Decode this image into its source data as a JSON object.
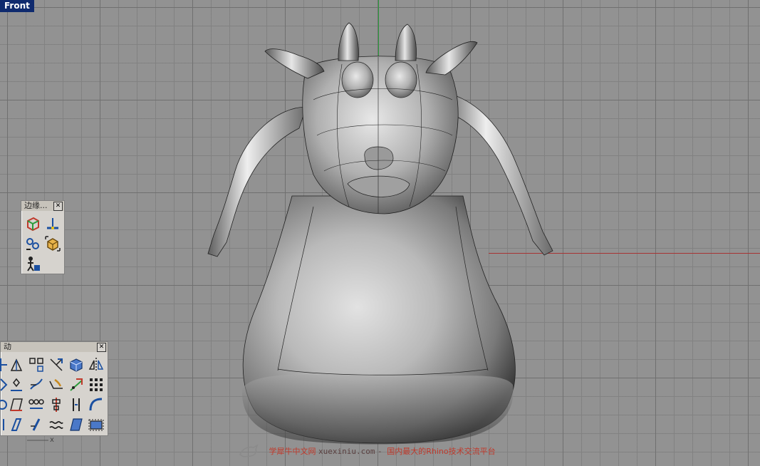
{
  "viewport": {
    "label": "Front"
  },
  "toolbars": {
    "edge": {
      "title": "边缘...",
      "close": "✕"
    },
    "transform": {
      "title": "动",
      "close": "✕"
    }
  },
  "watermark": {
    "site": "学犀牛中文网",
    "url": "xuexiniu.com",
    "sep": " - ",
    "slogan": "国内最大的Rhino技术交流平台"
  },
  "axis_indicator": {
    "label": "x"
  },
  "colors": {
    "x_axis": "#a83434",
    "y_axis": "#2a9a3a",
    "viewport_title_bg": "#0f2a6e"
  }
}
